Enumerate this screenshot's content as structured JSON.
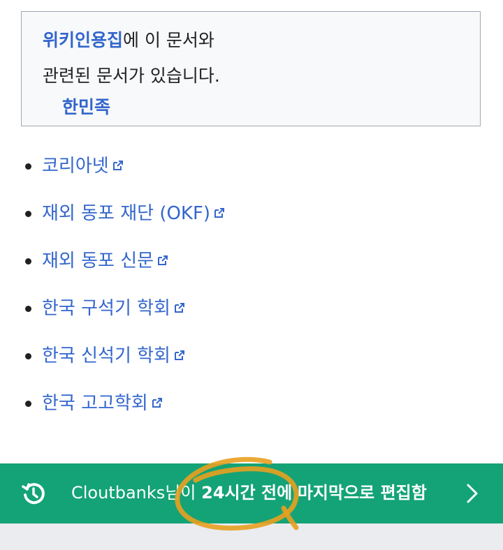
{
  "commons": {
    "link_label": "위키인용집",
    "text_after_link": "에 이 문서와",
    "line2": "관련된 문서가 있습니다.",
    "sub_link": "한민족"
  },
  "external_links": [
    {
      "label": "코리아넷"
    },
    {
      "label": "재외 동포 재단 (OKF)"
    },
    {
      "label": "재외 동포 신문"
    },
    {
      "label": "한국 구석기 학회"
    },
    {
      "label": "한국 신석기 학회"
    },
    {
      "label": "한국 고고학회"
    }
  ],
  "footer": {
    "user": "Cloutbanks님이",
    "time": "24시간 전에",
    "rest": "마지막으로 편집함",
    "background_color": "#14a376"
  },
  "colors": {
    "link": "#3366cc",
    "annotation": "#e8a020"
  },
  "icons": {
    "history": "history-icon",
    "chevron": "chevron-right-icon",
    "external": "external-link-icon"
  }
}
